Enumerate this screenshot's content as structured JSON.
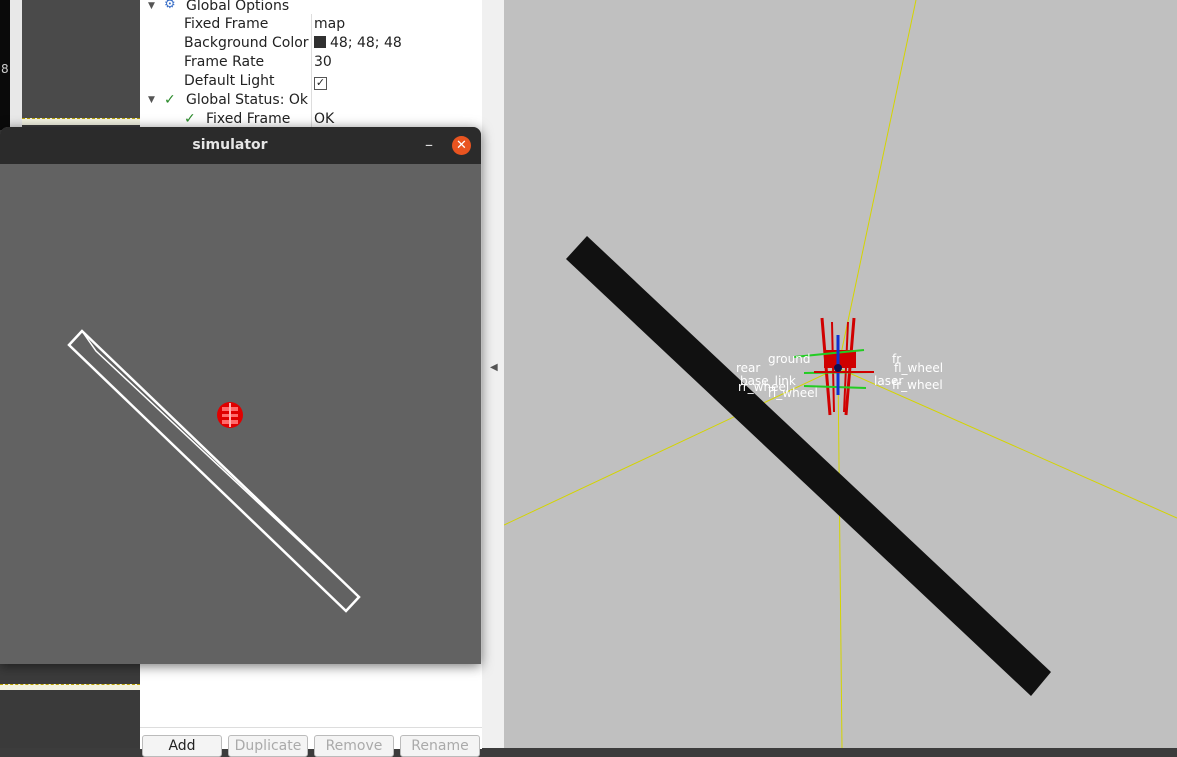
{
  "left_panel": {
    "scroll_number": "8"
  },
  "tree": {
    "rows": [
      {
        "label": "Global Options",
        "value": ""
      },
      {
        "label": "Fixed Frame",
        "value": "map"
      },
      {
        "label": "Background Color",
        "value": "48; 48; 48"
      },
      {
        "label": "Frame Rate",
        "value": "30"
      },
      {
        "label": "Default Light",
        "value": "✓"
      },
      {
        "label": "Global Status: Ok",
        "value": ""
      },
      {
        "label": "Fixed Frame",
        "value": "OK"
      }
    ],
    "buttons": {
      "add": "Add",
      "duplicate": "Duplicate",
      "remove": "Remove",
      "rename": "Rename"
    }
  },
  "simulator": {
    "title": "simulator",
    "minimize": "–",
    "close": "✕"
  },
  "view3d": {
    "frame_labels": [
      "ground",
      "fr",
      "fl_wheel",
      "rear",
      "base_link",
      "laser",
      "rr_wheel",
      "rl_wheel",
      "fr_wheel"
    ]
  },
  "colors": {
    "view_background": "#c0c0c0",
    "sim_background": "#626262",
    "close_button": "#e95420",
    "obstacle": "#111111",
    "grid_line": "#d4d400",
    "robot": "#e00000"
  },
  "icons": {
    "global_options": "gear-icon",
    "status_ok": "check-icon"
  }
}
